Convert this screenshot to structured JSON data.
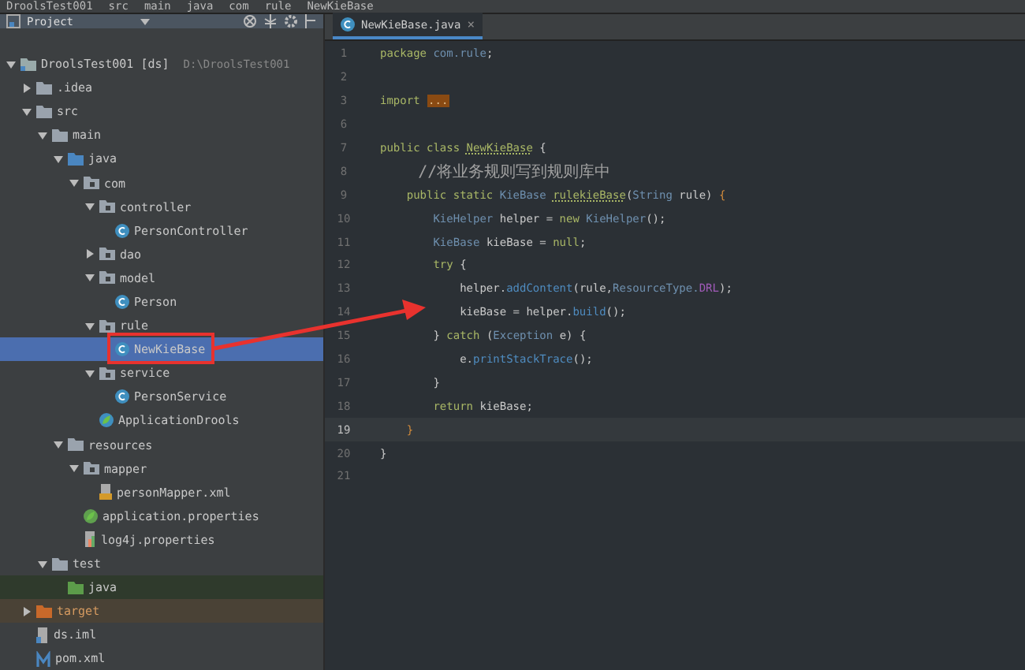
{
  "breadcrumb": [
    "DroolsTest001",
    "src",
    "main",
    "java",
    "com",
    "rule",
    "NewKieBase"
  ],
  "project_panel": {
    "title": "Project"
  },
  "tree": [
    {
      "label": "DroolsTest001 [ds]",
      "path": "D:\\DroolsTest001",
      "kind": "project",
      "expanded": true,
      "selected": false,
      "children": [
        {
          "label": ".idea",
          "kind": "folder",
          "expanded": false,
          "selected": false
        },
        {
          "label": "src",
          "kind": "folder",
          "expanded": true,
          "selected": false,
          "children": [
            {
              "label": "main",
              "kind": "folder",
              "expanded": true,
              "selected": false,
              "children": [
                {
                  "label": "java",
                  "kind": "source",
                  "expanded": true,
                  "selected": false,
                  "children": [
                    {
                      "label": "com",
                      "kind": "package",
                      "expanded": true,
                      "selected": false,
                      "children": [
                        {
                          "label": "controller",
                          "kind": "package",
                          "expanded": true,
                          "selected": false,
                          "children": [
                            {
                              "label": "PersonController",
                              "kind": "class",
                              "selected": false
                            }
                          ]
                        },
                        {
                          "label": "dao",
                          "kind": "package",
                          "expanded": false,
                          "selected": false
                        },
                        {
                          "label": "model",
                          "kind": "package",
                          "expanded": true,
                          "selected": false,
                          "children": [
                            {
                              "label": "Person",
                              "kind": "class",
                              "selected": false
                            }
                          ]
                        },
                        {
                          "label": "rule",
                          "kind": "package",
                          "expanded": true,
                          "selected": false,
                          "children": [
                            {
                              "label": "NewKieBase",
                              "kind": "class",
                              "selected": true
                            }
                          ]
                        },
                        {
                          "label": "service",
                          "kind": "package",
                          "expanded": true,
                          "selected": false,
                          "children": [
                            {
                              "label": "PersonService",
                              "kind": "class",
                              "selected": false
                            }
                          ]
                        },
                        {
                          "label": "ApplicationDrools",
                          "kind": "spring",
                          "selected": false
                        }
                      ]
                    }
                  ]
                },
                {
                  "label": "resources",
                  "kind": "resources",
                  "expanded": true,
                  "selected": false,
                  "children": [
                    {
                      "label": "mapper",
                      "kind": "package",
                      "expanded": true,
                      "selected": false,
                      "children": [
                        {
                          "label": "personMapper.xml",
                          "kind": "xml",
                          "selected": false
                        }
                      ]
                    },
                    {
                      "label": "application.properties",
                      "kind": "spring-file",
                      "selected": false
                    },
                    {
                      "label": "log4j.properties",
                      "kind": "properties",
                      "selected": false
                    }
                  ]
                }
              ]
            },
            {
              "label": "test",
              "kind": "folder",
              "expanded": true,
              "selected": false,
              "children": [
                {
                  "label": "java",
                  "kind": "test",
                  "selected": false
                }
              ]
            }
          ]
        },
        {
          "label": "target",
          "kind": "excluded",
          "expanded": false,
          "selected": false
        },
        {
          "label": "ds.iml",
          "kind": "iml",
          "selected": false
        },
        {
          "label": "pom.xml",
          "kind": "maven",
          "selected": false
        }
      ]
    }
  ],
  "editor_tab": {
    "label": "NewKieBase.java",
    "close": "×"
  },
  "code": [
    {
      "number": "1",
      "current": false,
      "tokens": [
        {
          "text": "package ",
          "kind": "keyword"
        },
        {
          "text": "com.rule",
          "kind": "type"
        },
        {
          "text": ";",
          "kind": "plain"
        }
      ]
    },
    {
      "number": "2",
      "current": false
    },
    {
      "number": "3",
      "current": false,
      "tokens": [
        {
          "text": "import ",
          "kind": "keyword"
        },
        {
          "text": "...",
          "kind": "fold"
        }
      ]
    },
    {
      "number": "6",
      "current": false
    },
    {
      "number": "7",
      "current": false,
      "tokens": [
        {
          "text": "public class ",
          "kind": "keyword"
        },
        {
          "text": "NewKieBase",
          "kind": "declaration"
        },
        {
          "text": " {",
          "kind": "plain"
        }
      ]
    },
    {
      "number": "8",
      "current": false,
      "tokens": [
        {
          "text": "    //将业务规则写到规则库中",
          "kind": "comment"
        }
      ]
    },
    {
      "number": "9",
      "current": false,
      "tokens": [
        {
          "text": "    public static ",
          "kind": "keyword"
        },
        {
          "text": "KieBase ",
          "kind": "type"
        },
        {
          "text": "rulekieBase",
          "kind": "declaration"
        },
        {
          "text": "(",
          "kind": "plain"
        },
        {
          "text": "String ",
          "kind": "type"
        },
        {
          "text": "rule) ",
          "kind": "plain"
        },
        {
          "text": "{",
          "kind": "brace"
        }
      ]
    },
    {
      "number": "10",
      "current": false,
      "tokens": [
        {
          "text": "        KieHelper ",
          "kind": "type"
        },
        {
          "text": "helper = ",
          "kind": "plain"
        },
        {
          "text": "new ",
          "kind": "keyword"
        },
        {
          "text": "KieHelper",
          "kind": "type"
        },
        {
          "text": "();",
          "kind": "plain"
        }
      ]
    },
    {
      "number": "11",
      "current": false,
      "tokens": [
        {
          "text": "        KieBase ",
          "kind": "type"
        },
        {
          "text": "kieBase = ",
          "kind": "plain"
        },
        {
          "text": "null",
          "kind": "keyword"
        },
        {
          "text": ";",
          "kind": "plain"
        }
      ]
    },
    {
      "number": "12",
      "current": false,
      "tokens": [
        {
          "text": "        try ",
          "kind": "keyword"
        },
        {
          "text": "{",
          "kind": "plain"
        }
      ]
    },
    {
      "number": "13",
      "current": false,
      "tokens": [
        {
          "text": "            helper.",
          "kind": "plain"
        },
        {
          "text": "addContent",
          "kind": "method"
        },
        {
          "text": "(rule,",
          "kind": "plain"
        },
        {
          "text": "ResourceType.",
          "kind": "type"
        },
        {
          "text": "DRL",
          "kind": "constant"
        },
        {
          "text": ");",
          "kind": "plain"
        }
      ]
    },
    {
      "number": "14",
      "current": false,
      "tokens": [
        {
          "text": "            kieBase = helper.",
          "kind": "plain"
        },
        {
          "text": "build",
          "kind": "method"
        },
        {
          "text": "();",
          "kind": "plain"
        }
      ]
    },
    {
      "number": "15",
      "current": false,
      "tokens": [
        {
          "text": "        } ",
          "kind": "plain"
        },
        {
          "text": "catch ",
          "kind": "keyword"
        },
        {
          "text": "(",
          "kind": "plain"
        },
        {
          "text": "Exception ",
          "kind": "type"
        },
        {
          "text": "e) {",
          "kind": "plain"
        }
      ]
    },
    {
      "number": "16",
      "current": false,
      "tokens": [
        {
          "text": "            e.",
          "kind": "plain"
        },
        {
          "text": "printStackTrace",
          "kind": "method"
        },
        {
          "text": "();",
          "kind": "plain"
        }
      ]
    },
    {
      "number": "17",
      "current": false,
      "tokens": [
        {
          "text": "        }",
          "kind": "plain"
        }
      ]
    },
    {
      "number": "18",
      "current": false,
      "tokens": [
        {
          "text": "        return ",
          "kind": "keyword"
        },
        {
          "text": "kieBase;",
          "kind": "plain"
        }
      ]
    },
    {
      "number": "19",
      "current": true,
      "tokens": [
        {
          "text": "    }",
          "kind": "brace"
        }
      ]
    },
    {
      "number": "20",
      "current": false,
      "tokens": [
        {
          "text": "}",
          "kind": "plain"
        }
      ]
    },
    {
      "number": "21",
      "current": false
    }
  ]
}
